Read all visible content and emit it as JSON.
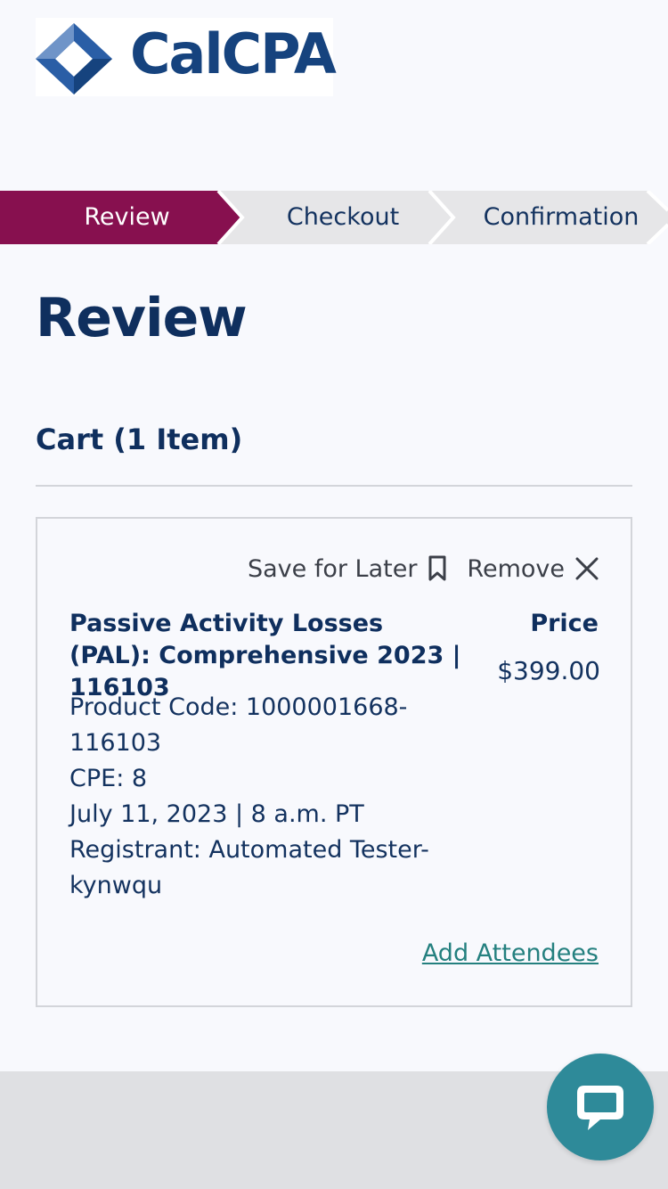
{
  "brand": {
    "name": "CalCPA"
  },
  "progress_steps": [
    {
      "label": "Review",
      "active": true
    },
    {
      "label": "Checkout",
      "active": false
    },
    {
      "label": "Confirmation",
      "active": false
    }
  ],
  "page_title": "Review",
  "cart": {
    "title": "Cart (1 Item)",
    "items": [
      {
        "save_for_later_label": "Save for Later",
        "remove_label": "Remove",
        "title": "Passive Activity Losses (PAL): Comprehensive 2023 | 116103",
        "price_label": "Price",
        "price": "$399.00",
        "product_code": "Product Code: 1000001668-116103",
        "cpe": "CPE: 8",
        "date": "July 11, 2023 | 8 a.m. PT",
        "registrant": "Registrant: Automated Tester-kynwqu",
        "add_attendees_label": "Add Attendees"
      }
    ]
  },
  "colors": {
    "active_step": "#87104f",
    "inactive_step": "#e6e6e8",
    "heading": "#0f2f5e",
    "link": "#24807f",
    "chat_button": "#2e8a99"
  },
  "icons": {
    "save_for_later": "bookmark-icon",
    "remove": "close-icon",
    "chat": "chat-bubble-icon"
  }
}
